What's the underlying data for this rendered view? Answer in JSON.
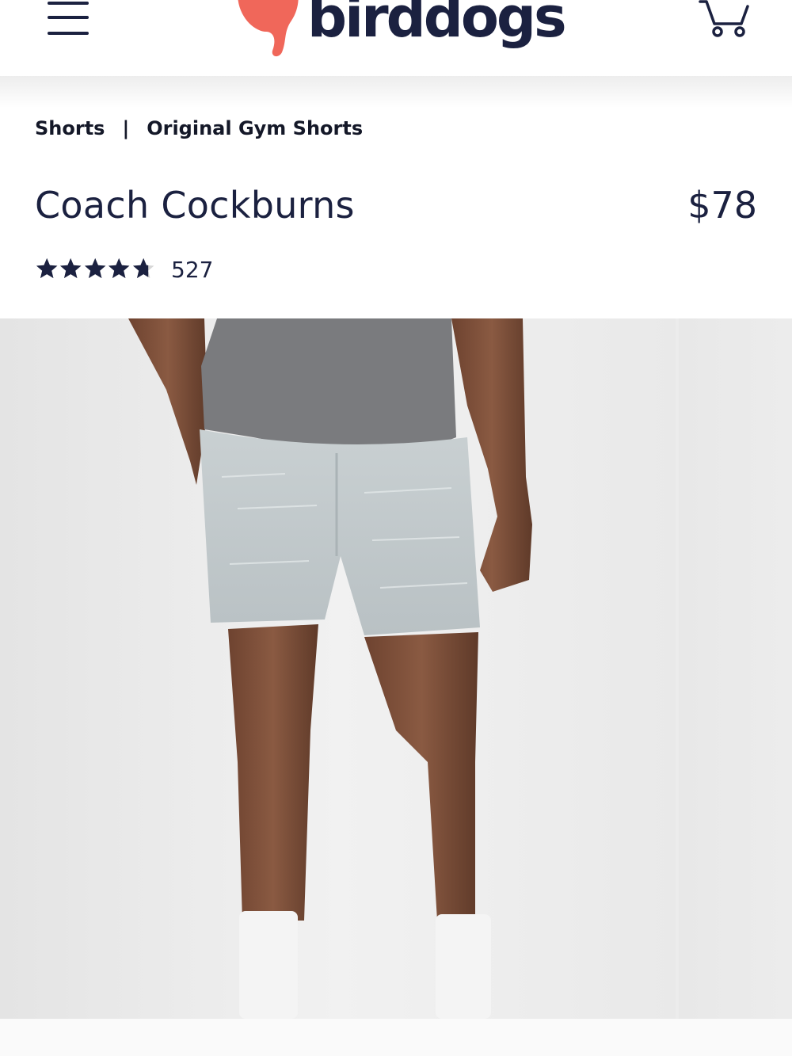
{
  "brand": {
    "name": "birddogs",
    "colors": {
      "navy": "#1b2140",
      "coral": "#f0675a"
    }
  },
  "header": {
    "menu_icon": "hamburger-menu-icon",
    "cart_icon": "shopping-cart-icon"
  },
  "breadcrumb": {
    "items": [
      "Shorts",
      "Original Gym Shorts"
    ],
    "separator": "|"
  },
  "product": {
    "title": "Coach Cockburns",
    "price": "$78",
    "rating": 4.7,
    "rating_max": 5,
    "review_count": "527"
  },
  "gallery": {
    "images": [
      "model-wearing-grey-heather-gym-shorts",
      "next-product-photo"
    ]
  }
}
